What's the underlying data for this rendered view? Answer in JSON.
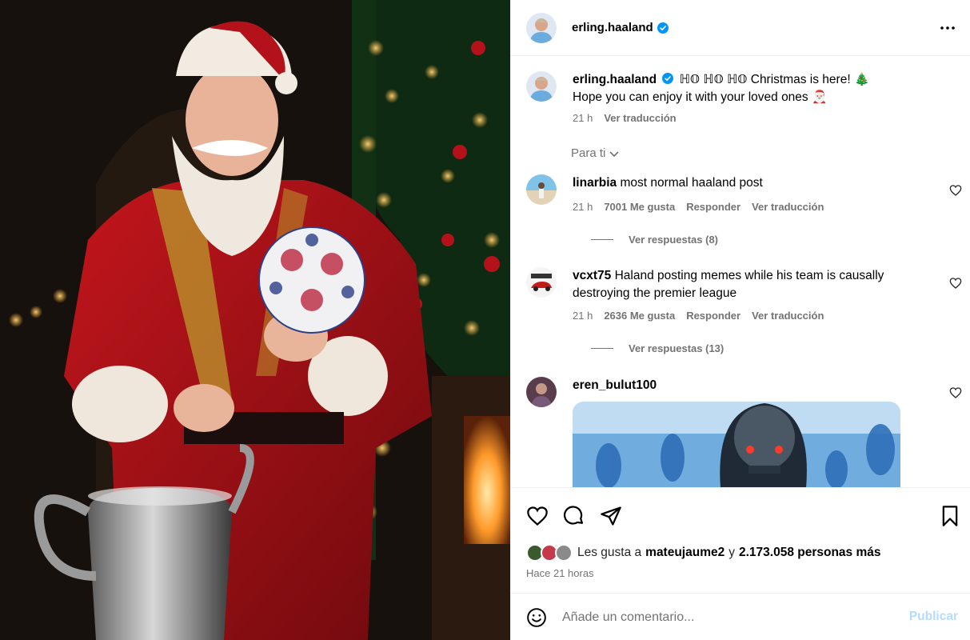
{
  "post": {
    "author": "erling.haaland",
    "caption_line1": "ℍ𝕆 ℍ𝕆 ℍ𝕆 Christmas is here! 🎄",
    "caption_line2": "Hope you can enjoy it with your loved ones 🎅🏻",
    "caption_time": "21 h",
    "caption_translate": "Ver traducción",
    "sort_label": "Para ti"
  },
  "comments": [
    {
      "user": "linarbia",
      "text": "most normal haaland post",
      "time": "21 h",
      "likes": "7001 Me gusta",
      "reply": "Responder",
      "translate": "Ver traducción",
      "replies": "Ver respuestas (8)"
    },
    {
      "user": "vcxt75",
      "text": "Haland posting memes while his team is causally destroying the premier league",
      "time": "21 h",
      "likes": "2636 Me gusta",
      "reply": "Responder",
      "translate": "Ver traducción",
      "replies": "Ver respuestas (13)"
    },
    {
      "user": "eren_bulut100",
      "text": ""
    }
  ],
  "likes": {
    "prefix": "Les gusta a",
    "user": "mateujaume2",
    "joiner": "y",
    "others": "2.173.058 personas más",
    "time_ago": "Hace 21 horas"
  },
  "composer": {
    "placeholder": "Añade un comentario...",
    "publish": "Publicar"
  },
  "icons": {
    "more": "more-dots-icon",
    "verified": "verified-badge-icon",
    "like": "heart-icon",
    "comment": "comment-bubble-icon",
    "share": "paper-plane-icon",
    "save": "bookmark-icon",
    "emoji": "smiley-icon",
    "sort": "chevron-down-icon"
  },
  "colors": {
    "verified": "#0095f6",
    "muted": "#737373",
    "publish_disabled": "#b3dbff",
    "divider": "#efefef"
  }
}
